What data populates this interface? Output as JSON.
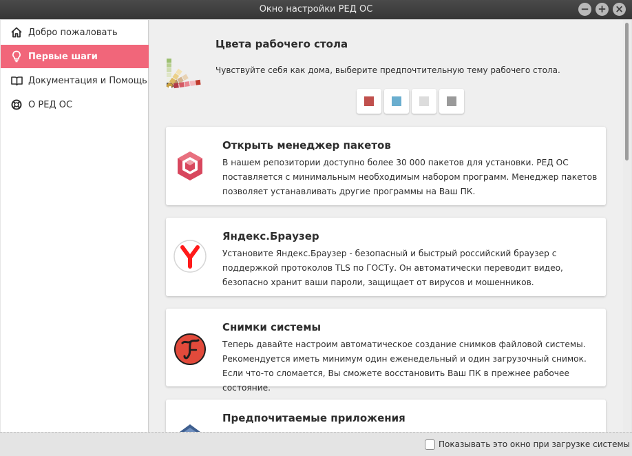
{
  "window": {
    "title": "Окно настройки РЕД ОС",
    "minimize_glyph": "−",
    "maximize_glyph": "+",
    "close_glyph": "×"
  },
  "sidebar": {
    "items": [
      {
        "label": "Добро пожаловать",
        "icon": "home-icon",
        "active": false
      },
      {
        "label": "Первые шаги",
        "icon": "lightbulb-icon",
        "active": true
      },
      {
        "label": "Документация и Помощь",
        "icon": "book-icon",
        "active": false
      },
      {
        "label": "О РЕД ОС",
        "icon": "lifebuoy-icon",
        "active": false
      }
    ]
  },
  "theme": {
    "title": "Цвета рабочего стола",
    "description": "Чувствуйте себя как дома, выберите предпочтительную тему рабочего стола.",
    "icon": "color-palette-icon",
    "swatches": [
      "#c0504d",
      "#6aaecf",
      "#dcdcdc",
      "#9a9a9a"
    ]
  },
  "cards": [
    {
      "title": "Открыть менеджер пакетов",
      "icon": "package-manager-icon",
      "lines": [
        "В нашем репозитории доступно более 30 000 пакетов для установки. РЕД ОС",
        "поставляется с минимальным необходимым набором программ. Менеджер пакетов",
        "позволяет устанавливать другие программы на Ваш ПК."
      ]
    },
    {
      "title": "Яндекс.Браузер",
      "icon": "yandex-browser-icon",
      "lines": [
        "Установите Яндекс.Браузер - безопасный и быстрый российский браузер с",
        "поддержкой протоколов TLS по ГОСТу. Он автоматически переводит видео,",
        "безопасно хранит ваши пароли, защищает от вирусов и мошенников."
      ]
    },
    {
      "title": "Снимки системы",
      "icon": "timeshift-icon",
      "lines": [
        "Теперь давайте настроим автоматическое создание снимков файловой системы.",
        "Рекомендуется иметь минимум один еженедельный и один загрузочный снимок.",
        "Если что-то сломается, Вы сможете восстановить Ваш ПК в прежнее рабочее",
        "состояние."
      ]
    },
    {
      "title": "Предпочитаемые приложения",
      "icon": "preferred-apps-icon",
      "lines": []
    }
  ],
  "footer": {
    "checkbox_label": "Показывать это окно при загрузке системы",
    "checked": false
  },
  "colors": {
    "accent": "#f1667a",
    "titlebar": "#3c3c3c"
  }
}
